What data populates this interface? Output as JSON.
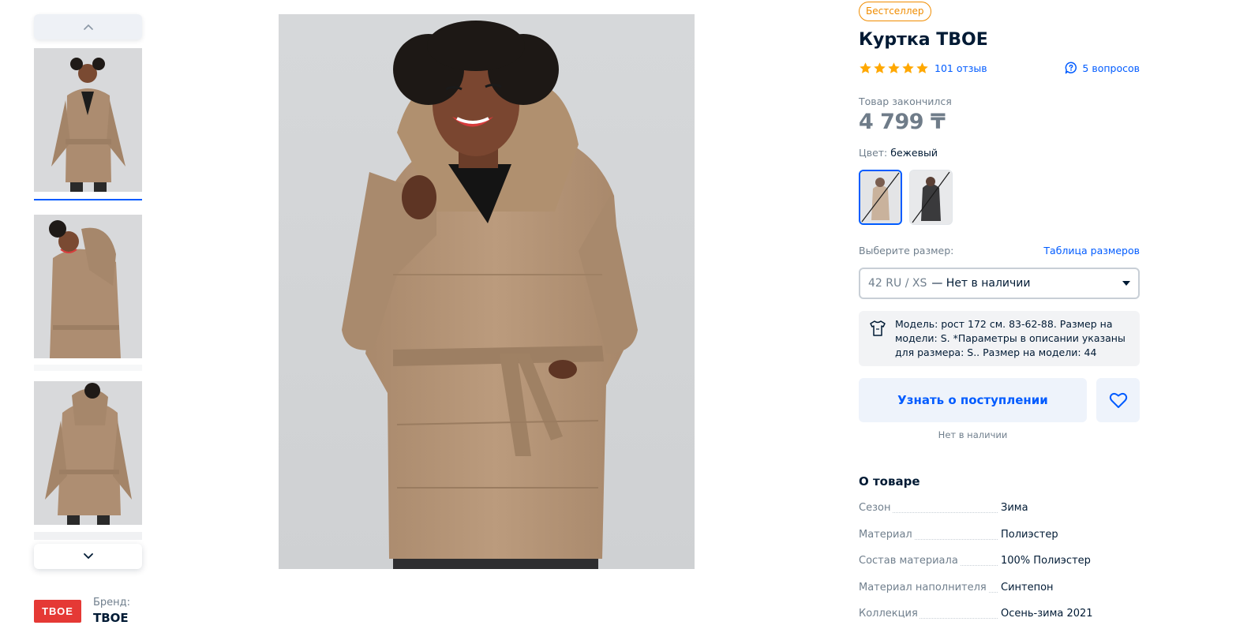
{
  "gallery": {
    "thumbnails": [
      {
        "view": "front",
        "active": true
      },
      {
        "view": "side",
        "active": false
      },
      {
        "view": "back",
        "active": false
      }
    ]
  },
  "brand": {
    "caption": "Бренд:",
    "name": "ТВОЕ",
    "logo_text": "ТВОЕ",
    "logo_color": "#e53935"
  },
  "product": {
    "badge": "Бестселлер",
    "title": "Куртка ТВОЕ",
    "rating": 5,
    "reviews": "101 отзыв",
    "questions": "5 вопросов",
    "sold_out_label": "Товар закончился",
    "price": "4 799 ₸",
    "color_label": "Цвет:",
    "color_value": "бежевый",
    "swatches": [
      {
        "color": "beige",
        "selected": true,
        "unavailable": true
      },
      {
        "color": "black",
        "selected": false,
        "unavailable": true
      }
    ],
    "size_label": "Выберите размер:",
    "size_table_link": "Таблица размеров",
    "size_selected": "42 RU / XS",
    "size_status": "— Нет в наличии",
    "model_info": "Модель: рост 172 см. 83-62-88. Размер на модели: S. *Параметры в описании указаны для размера: S.. Размер на модели: 44",
    "notify_button": "Узнать о поступлении",
    "not_available": "Нет в наличии"
  },
  "about": {
    "title": "О товаре",
    "specs": [
      {
        "key": "Сезон",
        "value": "Зима"
      },
      {
        "key": "Материал",
        "value": "Полиэстер"
      },
      {
        "key": "Состав материала",
        "value": "100% Полиэстер"
      },
      {
        "key": "Материал наполнителя",
        "value": "Синтепон"
      },
      {
        "key": "Коллекция",
        "value": "Осень-зима 2021"
      }
    ]
  },
  "colors": {
    "accent": "#005bff",
    "badge": "#f08c00",
    "star": "#ffa800",
    "jacket": "#b8987a",
    "price_muted": "#6f7c89"
  }
}
